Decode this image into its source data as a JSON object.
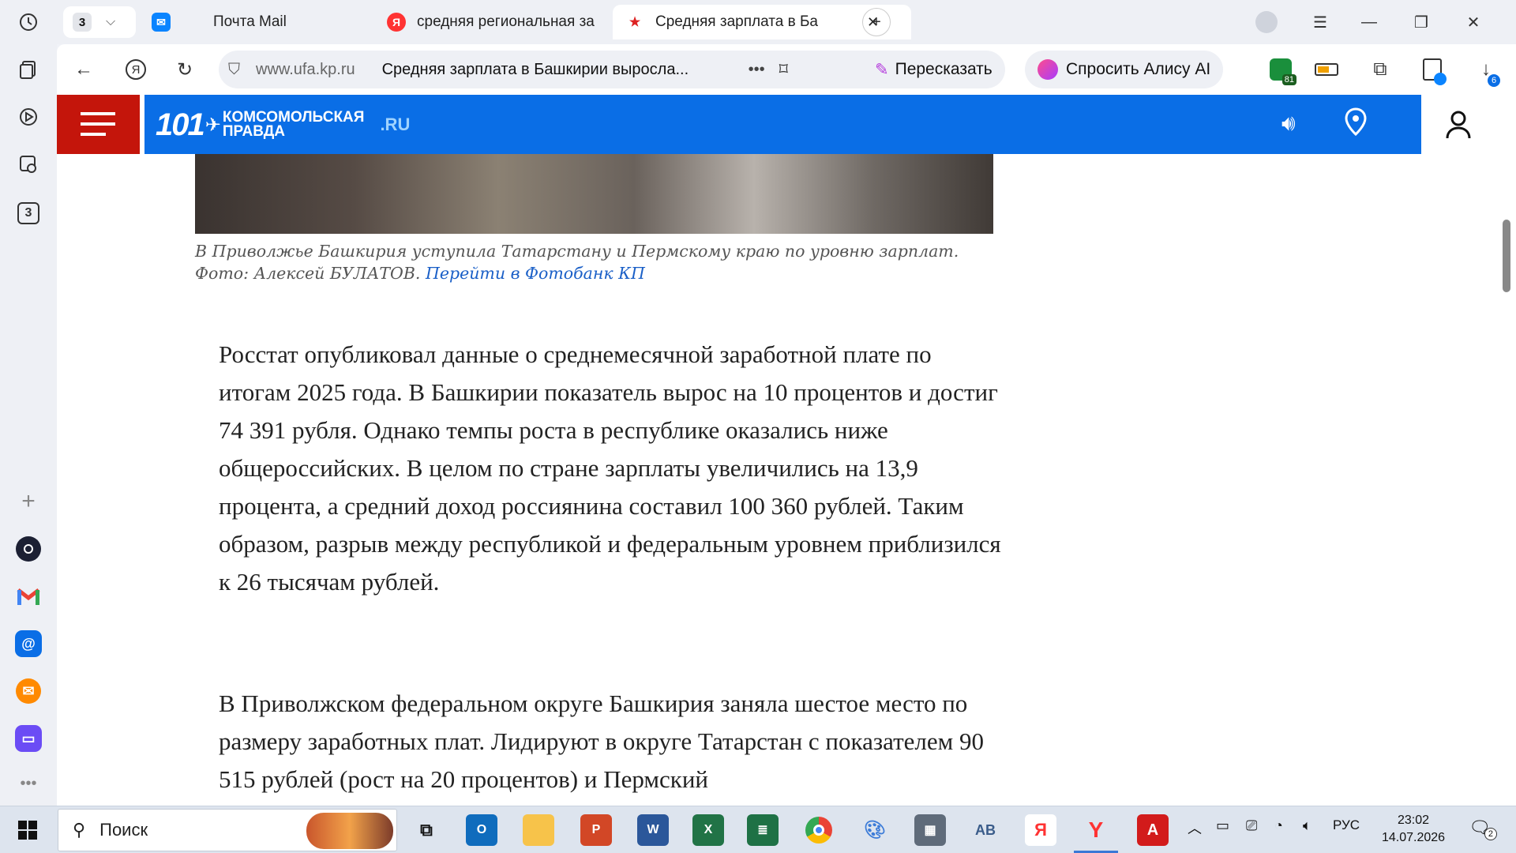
{
  "sidebar": {
    "tab_count": "3"
  },
  "tabs": {
    "group_count": "3",
    "items": [
      {
        "label": "Почта Mail"
      },
      {
        "label": "средняя региональная за"
      },
      {
        "label": "Средняя зарплата в Ба"
      }
    ]
  },
  "navbar": {
    "url": "www.ufa.kp.ru",
    "page_title": "Средняя зарплата в Башкирии выросла...",
    "retell_label": "Пересказать",
    "alice_label": "Спросить Алису AI",
    "ext_badge": "81",
    "downloads_badge": "6"
  },
  "site": {
    "logo_number": "101",
    "logo_line1": "КОМСОМОЛЬСКАЯ",
    "logo_line2": "ПРАВДА",
    "logo_domain": ".RU"
  },
  "article": {
    "caption_text": "В Приволжье Башкирия уступила Татарстану и Пермскому краю по уровню зарплат. Фото: Алексей БУЛАТОВ. ",
    "caption_link": "Перейти в Фотобанк КП",
    "paragraphs": [
      "Росстат опубликовал данные о среднемесячной заработной плате по итогам 2025 года. В Башкирии показатель вырос на 10 процентов и достиг 74 391 рубля. Однако темпы роста в республике оказались ниже общероссийских. В целом по стране зарплаты увеличились на 13,9 процента, а средний доход россиянина составил 100 360 рублей. Таким образом, разрыв между республикой и федеральным уровнем приблизился к 26 тысячам рублей.",
      "В Приволжском федеральном округе Башкирия заняла шестое место по размеру заработных плат. Лидируют в округе Татарстан с показателем 90 515 рублей (рост на 20 процентов) и Пермский"
    ]
  },
  "taskbar": {
    "search_placeholder": "Поиск",
    "lang": "РУС",
    "time": "23:02",
    "date": "14.07.2026",
    "notif_count": "2"
  }
}
